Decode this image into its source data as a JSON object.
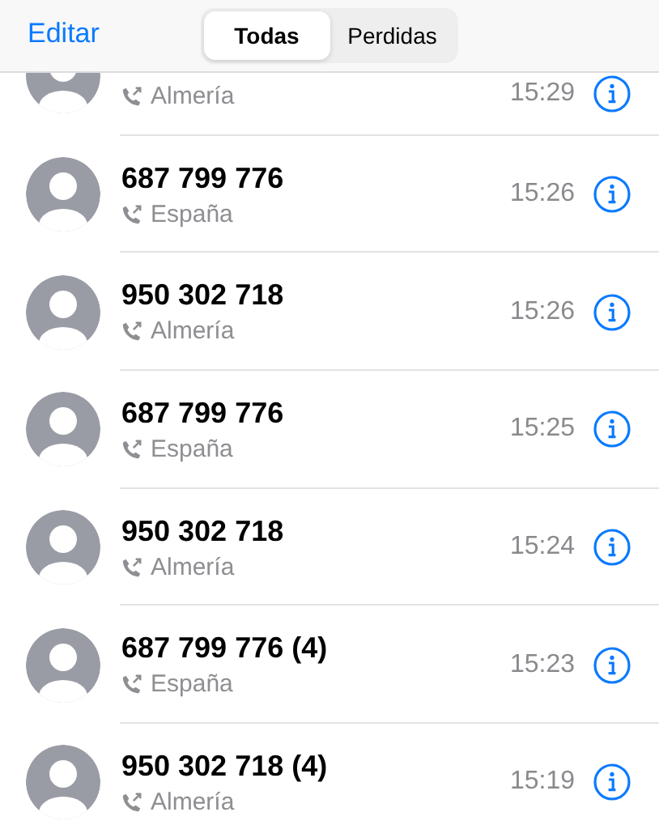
{
  "nav": {
    "edit": "Editar",
    "segments": [
      {
        "label": "Todas",
        "selected": true
      },
      {
        "label": "Perdidas",
        "selected": false
      }
    ]
  },
  "calls": [
    {
      "location": "Almería",
      "time": "15:29"
    },
    {
      "name": "687 799 776",
      "location": "España",
      "time": "15:26"
    },
    {
      "name": "950 302 718",
      "location": "Almería",
      "time": "15:26"
    },
    {
      "name": "687 799 776",
      "location": "España",
      "time": "15:25"
    },
    {
      "name": "950 302 718",
      "location": "Almería",
      "time": "15:24"
    },
    {
      "name": "687 799 776 (4)",
      "location": "España",
      "time": "15:23"
    },
    {
      "name": "950 302 718 (4)",
      "location": "Almería",
      "time": "15:19"
    }
  ]
}
